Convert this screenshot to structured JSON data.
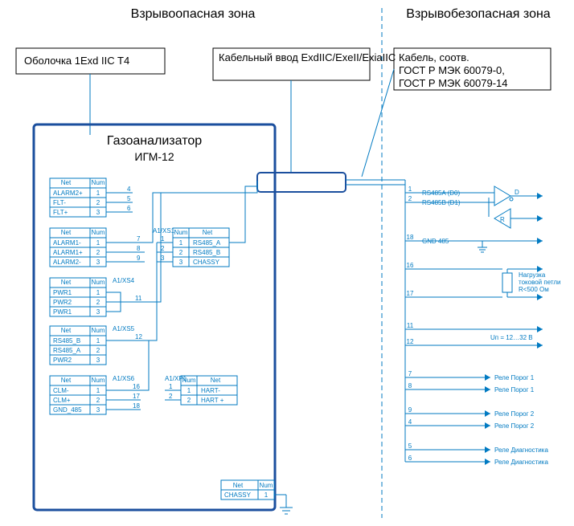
{
  "zones": {
    "hazardous": "Взрывоопасная зона",
    "safe": "Взрывобезопасная зона"
  },
  "label_enclosure": "Оболочка 1Exd IIC T4",
  "label_gland": "Кабельный ввод ExdIIC/ExeII/ExiaIIC",
  "label_cable1": "Кабель, соотв.",
  "label_cable2": "ГОСТ Р МЭК 60079-0,",
  "label_cable3": "ГОСТ Р МЭК 60079-14",
  "device": {
    "title": "Газоанализатор",
    "model": "ИГМ-12"
  },
  "hdr_net": "Net",
  "hdr_num": "Num",
  "t1": {
    "rows": [
      [
        "ALARM2+",
        "1"
      ],
      [
        "FLT-",
        "2"
      ],
      [
        "FLT+",
        "3"
      ]
    ],
    "legs": [
      "4",
      "5",
      "6"
    ]
  },
  "t2": {
    "rows": [
      [
        "ALARM1-",
        "1"
      ],
      [
        "ALARM1+",
        "2"
      ],
      [
        "ALARM2-",
        "3"
      ]
    ],
    "legs": [
      "7",
      "8",
      "9"
    ],
    "conn": "A1/XS1"
  },
  "t3": {
    "rows": [
      [
        "1",
        "RS485_A"
      ],
      [
        "2",
        "RS485_B"
      ],
      [
        "3",
        "CHASSY"
      ]
    ]
  },
  "t4": {
    "rows": [
      [
        "PWR1",
        "1"
      ],
      [
        "PWR2",
        "2"
      ],
      [
        "PWR1",
        "3"
      ]
    ],
    "conn": "A1/XS4",
    "leg": "11"
  },
  "t5": {
    "rows": [
      [
        "RS485_B",
        "1"
      ],
      [
        "RS485_A",
        "2"
      ],
      [
        "PWR2",
        "3"
      ]
    ],
    "conn": "A1/XS5",
    "leg": "12"
  },
  "t6": {
    "rows": [
      [
        "CLM-",
        "1"
      ],
      [
        "CLM+",
        "2"
      ],
      [
        "GND_485",
        "3"
      ]
    ],
    "conn": "A1/XS6",
    "legs": [
      "16",
      "17",
      "18"
    ]
  },
  "t7": {
    "rows": [
      [
        "1",
        "HART-"
      ],
      [
        "2",
        "HART +"
      ]
    ],
    "conn": "A1/XP1"
  },
  "t8": {
    "net": "CHASSY",
    "num": "1"
  },
  "right": {
    "pins": [
      {
        "n": "1",
        "lbl": "RS485A (D0)"
      },
      {
        "n": "2",
        "lbl": "RS485B (D1)"
      },
      {
        "n": "18",
        "lbl": "GND 485"
      },
      {
        "n": "16",
        "lbl": ""
      },
      {
        "n": "17",
        "lbl": ""
      },
      {
        "n": "11",
        "lbl": ""
      },
      {
        "n": "12",
        "lbl": ""
      },
      {
        "n": "7",
        "lbl": ""
      },
      {
        "n": "8",
        "lbl": ""
      },
      {
        "n": "9",
        "lbl": ""
      },
      {
        "n": "4",
        "lbl": ""
      },
      {
        "n": "5",
        "lbl": ""
      },
      {
        "n": "6",
        "lbl": ""
      }
    ],
    "loop1": "Нагрузка",
    "loop2": "токовой петли",
    "loop3": "R<500 Ом",
    "vrange": "Uп = 12…32 В",
    "relay1": "Реле Порог 1",
    "relay2": "Реле Порог 2",
    "relay3": "Реле Диагностика",
    "driver_d": "D",
    "driver_r": "R"
  }
}
